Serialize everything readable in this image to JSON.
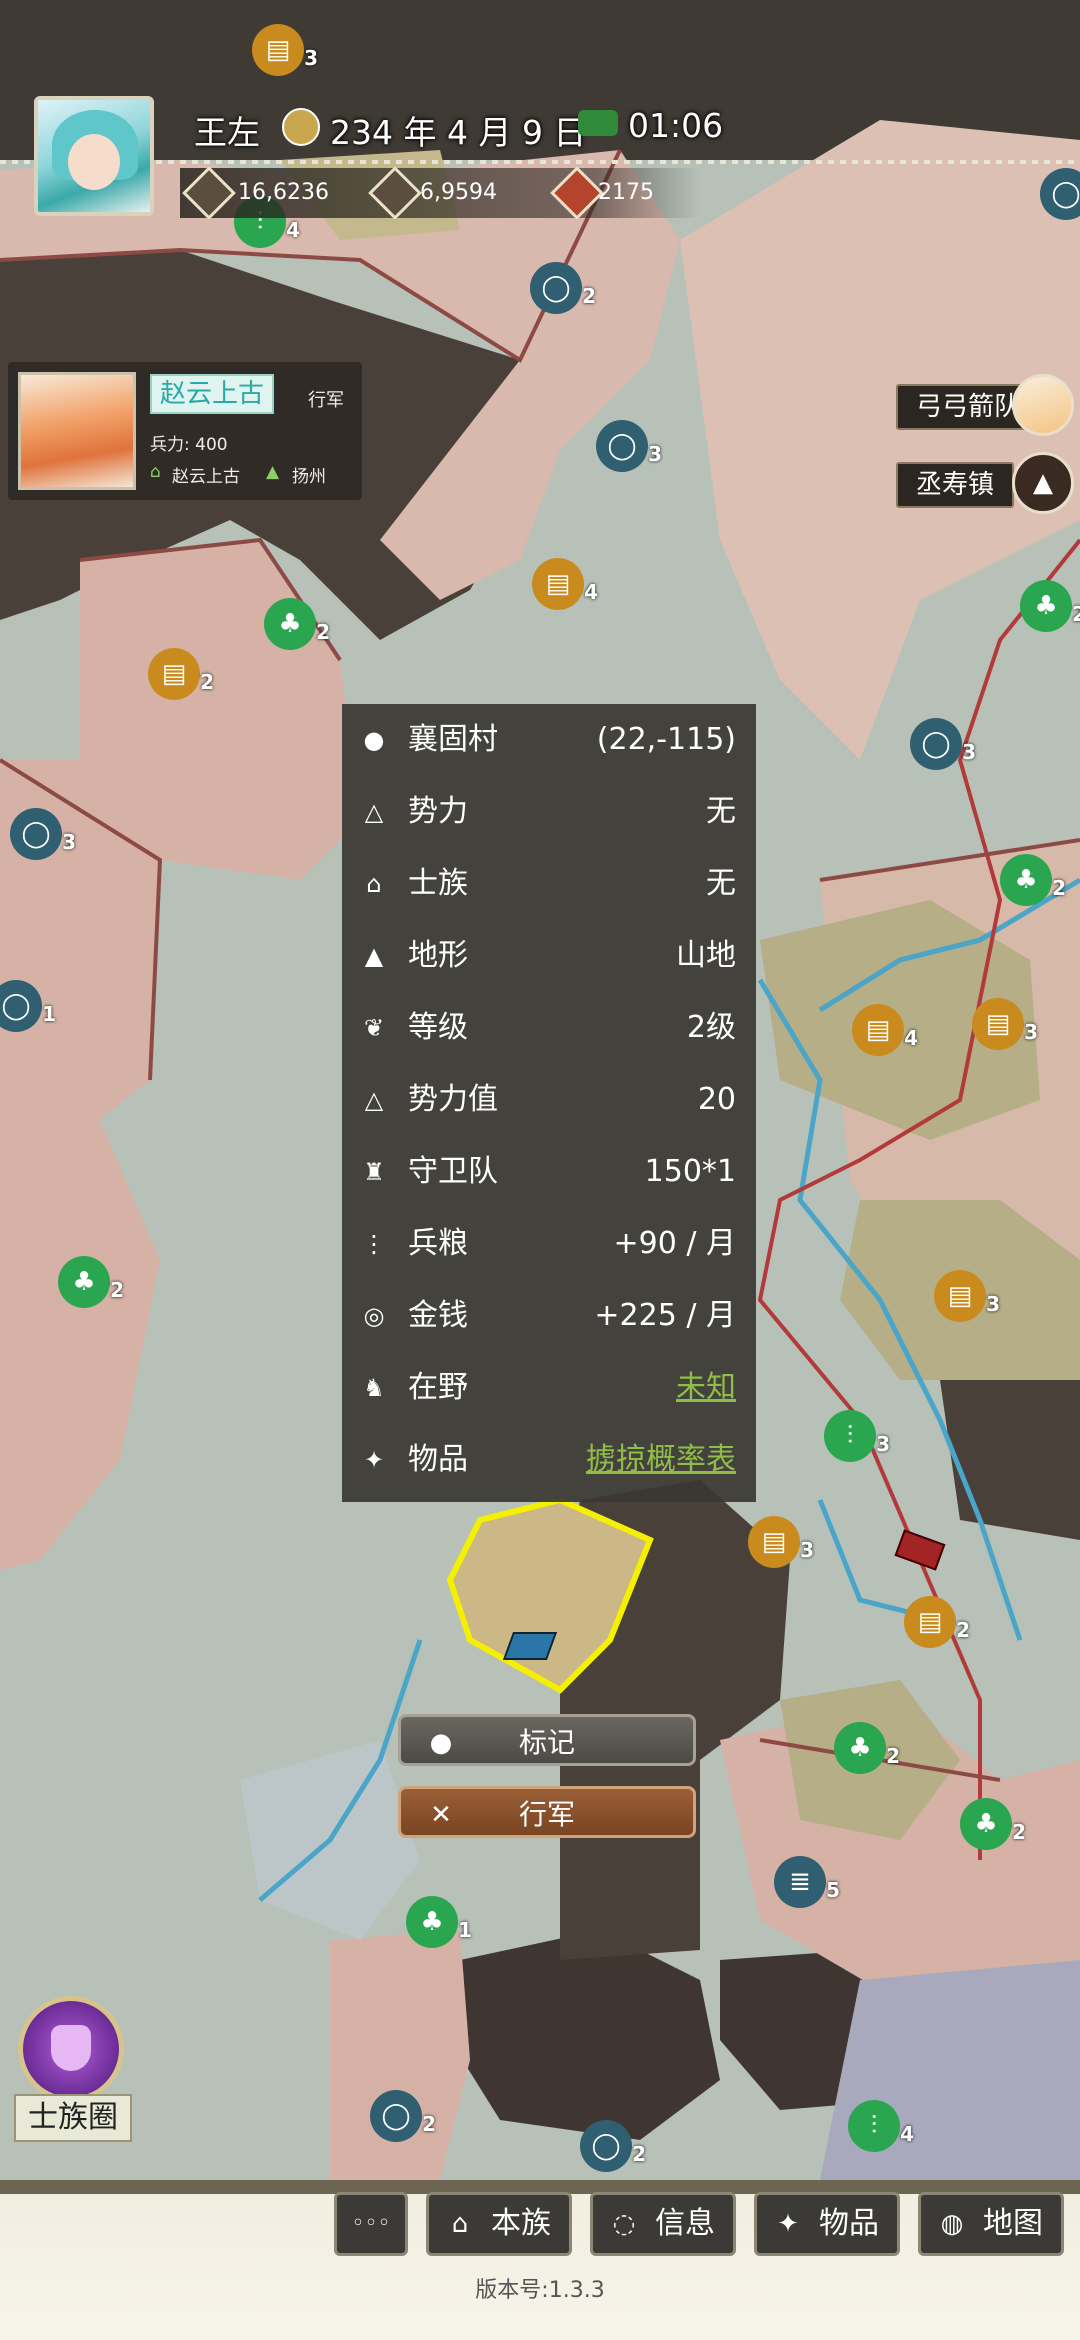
{
  "status": {
    "player_name": "王左",
    "date": "234 年 4 月 9 日",
    "time": "01:06",
    "resources": [
      {
        "icon": "silver-icon",
        "value": "16,6236"
      },
      {
        "icon": "grain-icon",
        "value": "6,9594"
      },
      {
        "icon": "meat-icon",
        "value": "2175"
      }
    ]
  },
  "general": {
    "name": "赵云上古",
    "action": "行军",
    "troops": "兵力: 400",
    "leader": "赵云上古",
    "location": "扬州"
  },
  "right_labels": [
    {
      "text": "弓弓箭队",
      "icon": "portrait-icon"
    },
    {
      "text": "丞寿镇",
      "icon": "mountain-icon"
    }
  ],
  "info_panel": {
    "rows": [
      {
        "icon": "location-pin-icon",
        "label": "襄固村",
        "value": "(22,-115)"
      },
      {
        "icon": "faction-icon",
        "label": "势力",
        "value": "无"
      },
      {
        "icon": "clan-icon",
        "label": "士族",
        "value": "无"
      },
      {
        "icon": "terrain-icon",
        "label": "地形",
        "value": "山地"
      },
      {
        "icon": "rank-icon",
        "label": "等级",
        "value": "2级"
      },
      {
        "icon": "faction-icon",
        "label": "势力值",
        "value": "20"
      },
      {
        "icon": "guard-icon",
        "label": "守卫队",
        "value": "150*1"
      },
      {
        "icon": "grain-icon",
        "label": "兵粮",
        "value": "+90 / 月"
      },
      {
        "icon": "coin-icon",
        "label": "金钱",
        "value": "+225 / 月"
      },
      {
        "icon": "wild-icon",
        "label": "在野",
        "value": "未知",
        "link": true
      },
      {
        "icon": "item-icon",
        "label": "物品",
        "value": "掳掠概率表",
        "link": true
      }
    ]
  },
  "actions": {
    "mark": "标记",
    "march": "行军"
  },
  "clan_circle": "士族圈",
  "bottom_nav": {
    "more": "◦◦◦",
    "tabs": [
      {
        "icon": "clan-icon",
        "label": "本族"
      },
      {
        "icon": "message-icon",
        "label": "信息"
      },
      {
        "icon": "item-icon",
        "label": "物品"
      },
      {
        "icon": "map-icon",
        "label": "地图"
      }
    ]
  },
  "version": "版本号:1.3.3",
  "map_markers": [
    {
      "kind": "book",
      "count": "3"
    },
    {
      "kind": "stone",
      "count": "2"
    },
    {
      "kind": "stone",
      "count": "3"
    },
    {
      "kind": "book",
      "count": "4"
    },
    {
      "kind": "tree",
      "count": "2"
    },
    {
      "kind": "book",
      "count": "2"
    },
    {
      "kind": "stone",
      "count": "3"
    },
    {
      "kind": "stone",
      "count": "1"
    },
    {
      "kind": "tree",
      "count": "2"
    },
    {
      "kind": "stone",
      "count": "3"
    },
    {
      "kind": "tree",
      "count": "2"
    },
    {
      "kind": "book",
      "count": "4"
    },
    {
      "kind": "book",
      "count": "3"
    },
    {
      "kind": "book",
      "count": "3"
    },
    {
      "kind": "bamboo",
      "count": "3"
    },
    {
      "kind": "book",
      "count": "3"
    },
    {
      "kind": "book",
      "count": "2"
    },
    {
      "kind": "tree",
      "count": "2"
    },
    {
      "kind": "tree",
      "count": "2"
    },
    {
      "kind": "coins",
      "count": "5"
    },
    {
      "kind": "tree",
      "count": "1"
    },
    {
      "kind": "stone",
      "count": "2"
    },
    {
      "kind": "stone",
      "count": "2"
    },
    {
      "kind": "bamboo",
      "count": "4"
    },
    {
      "kind": "bamboo",
      "count": "4"
    },
    {
      "kind": "stone",
      "count": "2"
    },
    {
      "kind": "tree",
      "count": "2"
    }
  ]
}
